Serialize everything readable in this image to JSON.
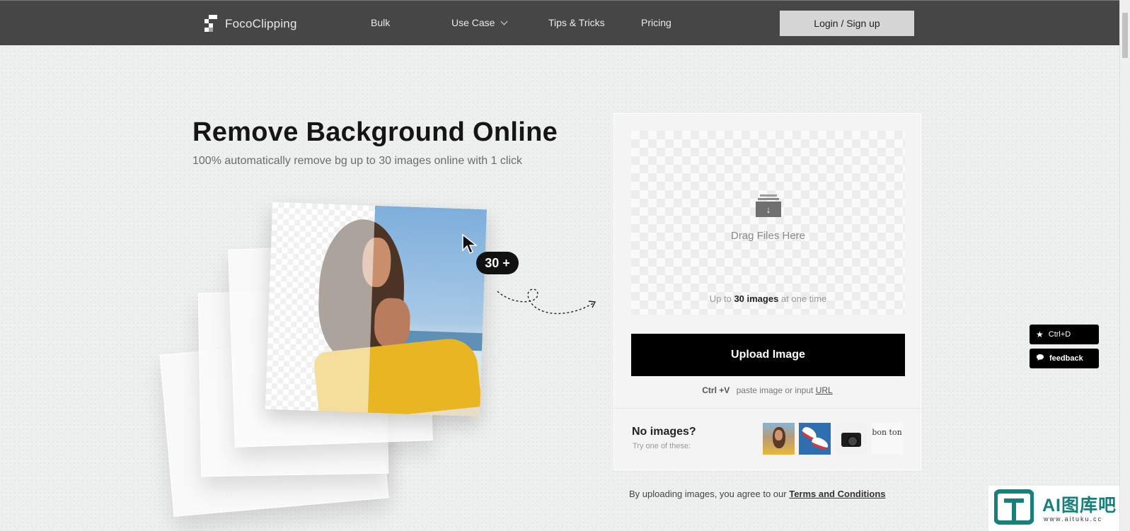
{
  "nav": {
    "logo_text": "FocoClipping",
    "links": [
      {
        "label": "Bulk"
      },
      {
        "label": "Use Case"
      },
      {
        "label": "Tips & Tricks"
      },
      {
        "label": "Pricing"
      }
    ],
    "login_label": "Login / Sign up"
  },
  "hero": {
    "title": "Remove Background Online",
    "subtitle": "100% automatically remove bg up to 30 images online with 1 click",
    "badge": "30 +"
  },
  "upload": {
    "drag_text": "Drag Files Here",
    "limit_prefix": "Up to",
    "limit_bold": "30 images",
    "limit_suffix": "at one time",
    "button_label": "Upload Image",
    "paste_shortcut": "Ctrl +V",
    "paste_text": "paste image or input",
    "paste_link": "URL",
    "no_images_title": "No images?",
    "no_images_sub": "Try one of these:",
    "sample_4_text": "bon ton"
  },
  "terms": {
    "prefix": "By uploading images, you agree to our",
    "link": "Terms and Conditions"
  },
  "side": {
    "bookmark_label": "Ctrl+D",
    "feedback_label": "feedback"
  },
  "watermark": {
    "title": "AI图库吧",
    "url": "www.aituku.cc"
  },
  "colors": {
    "nav_bg": "#464646",
    "primary_button": "#000000",
    "watermark_accent": "#17807a"
  },
  "icons": [
    "logo-icon",
    "chevron-down-icon",
    "cursor-icon",
    "download-tray-icon",
    "star-icon",
    "chat-bubble-icon"
  ]
}
